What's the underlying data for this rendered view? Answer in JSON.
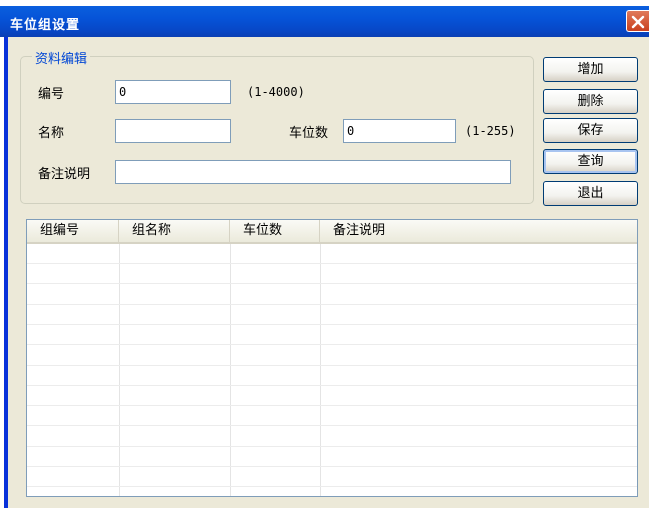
{
  "window": {
    "title": "车位组设置"
  },
  "form": {
    "group_title": "资料编辑",
    "id_label": "编号",
    "id_value": "0",
    "id_hint": "(1-4000)",
    "name_label": "名称",
    "name_value": "",
    "slots_label": "车位数",
    "slots_value": "0",
    "slots_hint": "(1-255)",
    "note_label": "备注说明",
    "note_value": ""
  },
  "buttons": {
    "add": "增加",
    "delete": "删除",
    "save": "保存",
    "query": "查询",
    "exit": "退出"
  },
  "table": {
    "columns": [
      "组编号",
      "组名称",
      "车位数",
      "备注说明"
    ],
    "rows": []
  }
}
